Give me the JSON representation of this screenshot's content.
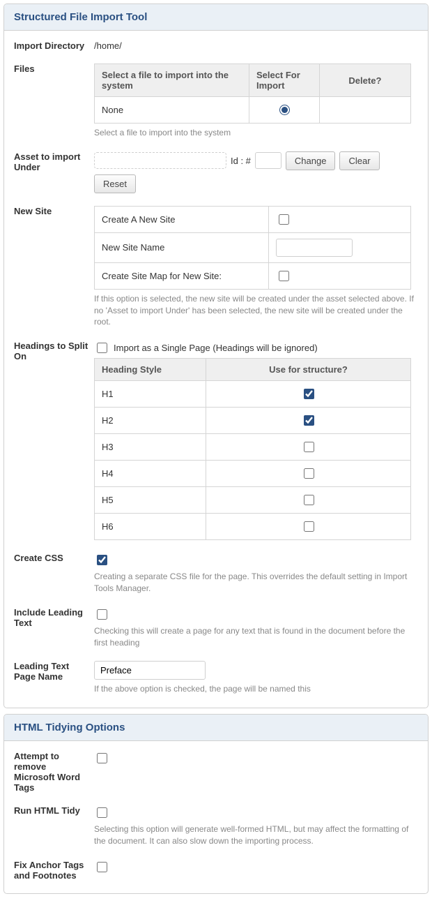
{
  "section1": {
    "title": "Structured File Import Tool",
    "import_dir_label": "Import Directory",
    "import_dir_value": "/home/",
    "files": {
      "label": "Files",
      "th_file": "Select a file to import into the system",
      "th_select": "Select For Import",
      "th_delete": "Delete?",
      "row_file": "None",
      "help": "Select a file to import into the system"
    },
    "asset": {
      "label": "Asset to import Under",
      "idhash": "Id : #",
      "change": "Change",
      "clear": "Clear",
      "reset": "Reset"
    },
    "newsite": {
      "label": "New Site",
      "create_label": "Create A New Site",
      "name_label": "New Site Name",
      "sitemap_label": "Create Site Map for New Site:",
      "help": "If this option is selected, the new site will be created under the asset selected above. If no 'Asset to import Under' has been selected, the new site will be created under the root."
    },
    "headings": {
      "label": "Headings to Split On",
      "single_label": "Import as a Single Page (Headings will be ignored)",
      "th_style": "Heading Style",
      "th_use": "Use for structure?",
      "rows": [
        "H1",
        "H2",
        "H3",
        "H4",
        "H5",
        "H6"
      ],
      "checked": [
        true,
        true,
        false,
        false,
        false,
        false
      ]
    },
    "createcss": {
      "label": "Create CSS",
      "help": "Creating a separate CSS file for the page. This overrides the default setting in Import Tools Manager."
    },
    "leadtext": {
      "label": "Include Leading Text",
      "help": "Checking this will create a page for any text that is found in the document before the first heading"
    },
    "leadname": {
      "label": "Leading Text Page Name",
      "value": "Preface",
      "help": "If the above option is checked, the page will be named this"
    }
  },
  "section2": {
    "title": "HTML Tidying Options",
    "removeword": {
      "label": "Attempt to remove Microsoft Word Tags"
    },
    "runtidy": {
      "label": "Run HTML Tidy",
      "help": "Selecting this option will generate well-formed HTML, but may affect the formatting of the document. It can also slow down the importing process."
    },
    "fixanchor": {
      "label": "Fix Anchor Tags and Footnotes"
    }
  }
}
